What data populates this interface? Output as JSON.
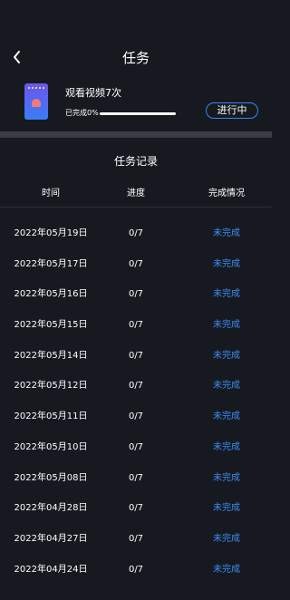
{
  "nav": {
    "title": "任务"
  },
  "task": {
    "name": "观看视频7次",
    "progress_label": "已完成0%",
    "progress": 0,
    "status_button": "进行中"
  },
  "records": {
    "title": "任务记录",
    "columns": [
      "时间",
      "进度",
      "完成情况"
    ],
    "rows": [
      {
        "date": "2022年05月19日",
        "progress": "0/7",
        "status": "未完成"
      },
      {
        "date": "2022年05月17日",
        "progress": "0/7",
        "status": "未完成"
      },
      {
        "date": "2022年05月16日",
        "progress": "0/7",
        "status": "未完成"
      },
      {
        "date": "2022年05月15日",
        "progress": "0/7",
        "status": "未完成"
      },
      {
        "date": "2022年05月14日",
        "progress": "0/7",
        "status": "未完成"
      },
      {
        "date": "2022年05月12日",
        "progress": "0/7",
        "status": "未完成"
      },
      {
        "date": "2022年05月11日",
        "progress": "0/7",
        "status": "未完成"
      },
      {
        "date": "2022年05月10日",
        "progress": "0/7",
        "status": "未完成"
      },
      {
        "date": "2022年05月08日",
        "progress": "0/7",
        "status": "未完成"
      },
      {
        "date": "2022年04月28日",
        "progress": "0/7",
        "status": "未完成"
      },
      {
        "date": "2022年04月27日",
        "progress": "0/7",
        "status": "未完成"
      },
      {
        "date": "2022年04月24日",
        "progress": "0/7",
        "status": "未完成"
      }
    ]
  },
  "colors": {
    "background": "#161a20",
    "accent": "#3d8bf5",
    "divider": "#3a3e44"
  },
  "icons": {
    "back": "chevron-left-icon",
    "thumbnail": "video-thumbnail-icon"
  }
}
